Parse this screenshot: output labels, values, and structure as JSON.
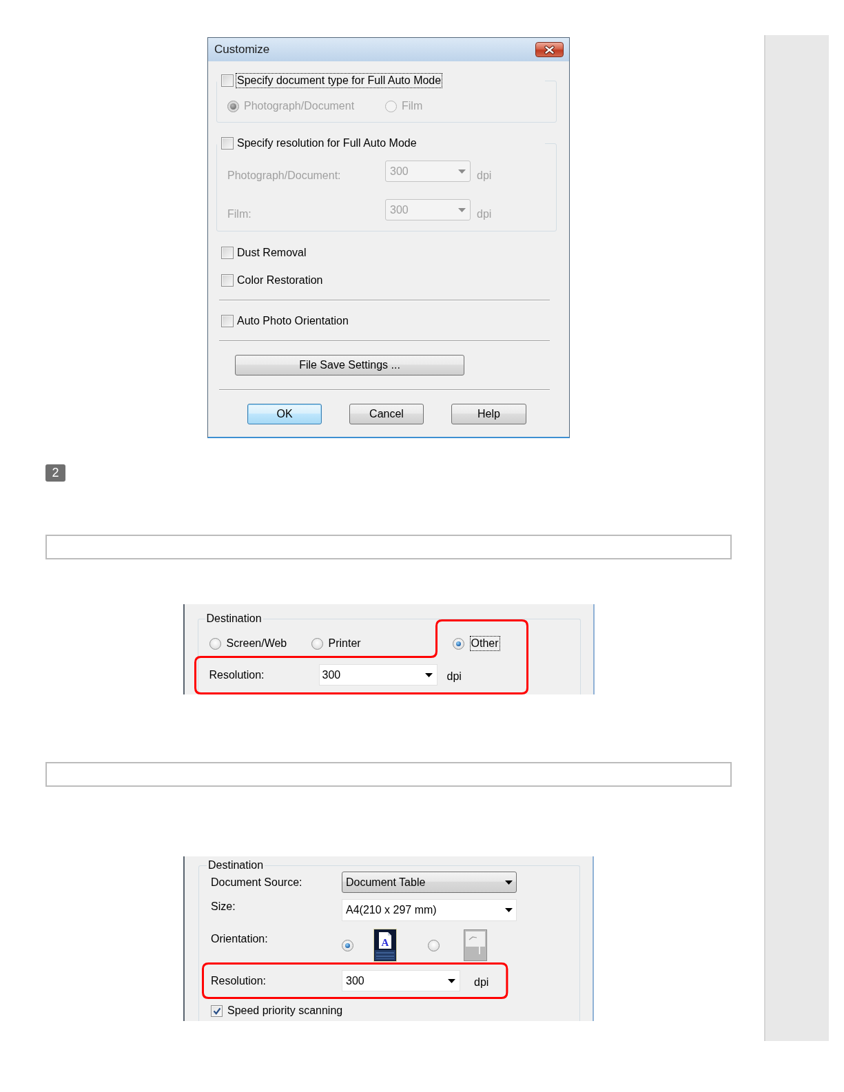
{
  "content": [
    {
      "kind": "dialog",
      "title": "Customize",
      "document_type": {
        "label": "Specify document type for Full Auto Mode",
        "checked": false,
        "focused": true,
        "options": [
          {
            "label": "Photograph/Document",
            "selected": true,
            "disabled": true
          },
          {
            "label": "Film",
            "selected": false,
            "disabled": true
          }
        ]
      },
      "resolution": {
        "label": "Specify resolution for Full Auto Mode",
        "checked": false,
        "focused": false,
        "rows": [
          {
            "label": "Photograph/Document:",
            "value": "300",
            "unit": "dpi",
            "disabled": true
          },
          {
            "label": "Film:",
            "value": "300",
            "unit": "dpi",
            "disabled": true
          }
        ]
      },
      "option_groups": [
        {
          "items": [
            {
              "label": "Dust Removal",
              "checked": false
            },
            {
              "label": "Color Restoration",
              "checked": false
            }
          ]
        },
        {
          "items": [
            {
              "label": "Auto Photo Orientation",
              "checked": false
            }
          ]
        }
      ],
      "file_save_button": {
        "label": "File Save Settings ..."
      },
      "buttons": [
        {
          "label": "OK",
          "default": true
        },
        {
          "label": "Cancel",
          "default": false
        },
        {
          "label": "Help",
          "default": false
        }
      ]
    },
    {
      "kind": "step",
      "number": "2"
    },
    {
      "kind": "blank_box"
    },
    {
      "kind": "destination_panel",
      "group_label": "Destination",
      "destinations": [
        {
          "label": "Screen/Web",
          "selected": false,
          "focused": false,
          "highlighted": false
        },
        {
          "label": "Printer",
          "selected": false,
          "focused": false,
          "highlighted": false
        },
        {
          "label": "Other",
          "selected": true,
          "focused": true,
          "highlighted": true
        }
      ],
      "resolution": {
        "label": "Resolution:",
        "value": "300",
        "unit": "dpi",
        "highlighted": true
      }
    },
    {
      "kind": "blank_box"
    },
    {
      "kind": "scan_panel",
      "group_label": "Destination",
      "document_source": {
        "label": "Document Source:",
        "value": "Document Table"
      },
      "size": {
        "label": "Size:",
        "value": "A4(210 x 297 mm)"
      },
      "orientation": {
        "label": "Orientation:",
        "options": [
          {
            "kind": "portrait",
            "glyph": "A",
            "selected": true
          },
          {
            "kind": "landscape",
            "selected": false
          }
        ]
      },
      "resolution": {
        "label": "Resolution:",
        "value": "300",
        "unit": "dpi",
        "highlighted": true
      },
      "speed_priority": {
        "label": "Speed priority scanning",
        "checked": true
      }
    }
  ]
}
